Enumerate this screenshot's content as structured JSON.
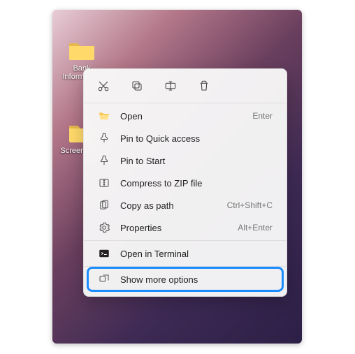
{
  "desktop": {
    "icons": [
      {
        "label": "Bank Information"
      },
      {
        "label": "Screenshots"
      }
    ]
  },
  "toolbar": {
    "cut": "Cut",
    "copy": "Copy",
    "rename": "Rename",
    "delete": "Delete"
  },
  "menu": {
    "open": {
      "label": "Open",
      "shortcut": "Enter"
    },
    "pin_quick": {
      "label": "Pin to Quick access"
    },
    "pin_start": {
      "label": "Pin to Start"
    },
    "compress": {
      "label": "Compress to ZIP file"
    },
    "copy_path": {
      "label": "Copy as path",
      "shortcut": "Ctrl+Shift+C"
    },
    "properties": {
      "label": "Properties",
      "shortcut": "Alt+Enter"
    },
    "terminal": {
      "label": "Open in Terminal"
    },
    "more": {
      "label": "Show more options"
    }
  }
}
